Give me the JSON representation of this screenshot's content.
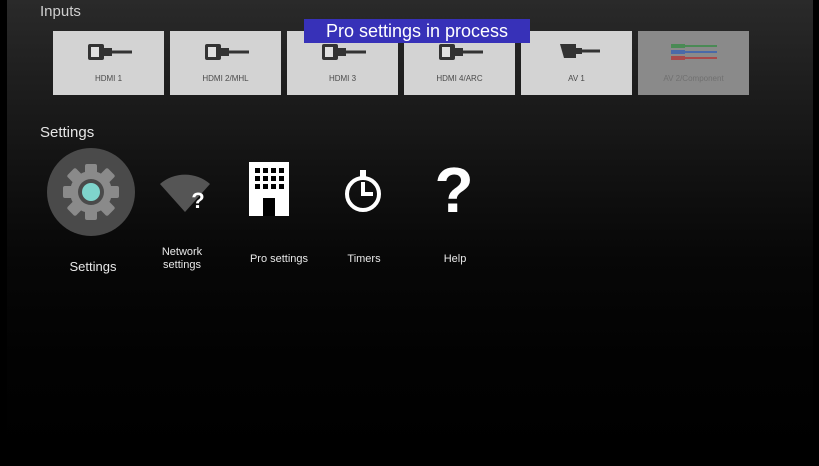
{
  "banner": {
    "text": "Pro settings in process"
  },
  "inputs": {
    "title": "Inputs",
    "items": [
      {
        "label": "HDMI 1",
        "icon": "hdmi-cable-icon"
      },
      {
        "label": "HDMI 2/MHL",
        "icon": "hdmi-cable-icon"
      },
      {
        "label": "HDMI 3",
        "icon": "hdmi-cable-icon"
      },
      {
        "label": "HDMI 4/ARC",
        "icon": "hdmi-cable-icon"
      },
      {
        "label": "AV 1",
        "icon": "scart-cable-icon"
      },
      {
        "label": "AV 2/Component",
        "icon": "component-cable-icon"
      }
    ]
  },
  "settings": {
    "title": "Settings",
    "items": [
      {
        "label": "Settings",
        "icon": "gear-icon",
        "selected": true
      },
      {
        "label_line1": "Network",
        "label_line2": "settings",
        "icon": "wifi-question-icon"
      },
      {
        "label": "Pro settings",
        "icon": "building-icon"
      },
      {
        "label": "Timers",
        "icon": "timer-icon"
      },
      {
        "label": "Help",
        "icon": "question-mark-icon"
      }
    ]
  },
  "colors": {
    "banner_bg": "#3731b8",
    "tile_bg": "#d3d3d3",
    "tile_disabled_bg": "#8a8a8a",
    "selected_circle": "#4a4a4a",
    "gear_accent": "#7fd4cc"
  }
}
